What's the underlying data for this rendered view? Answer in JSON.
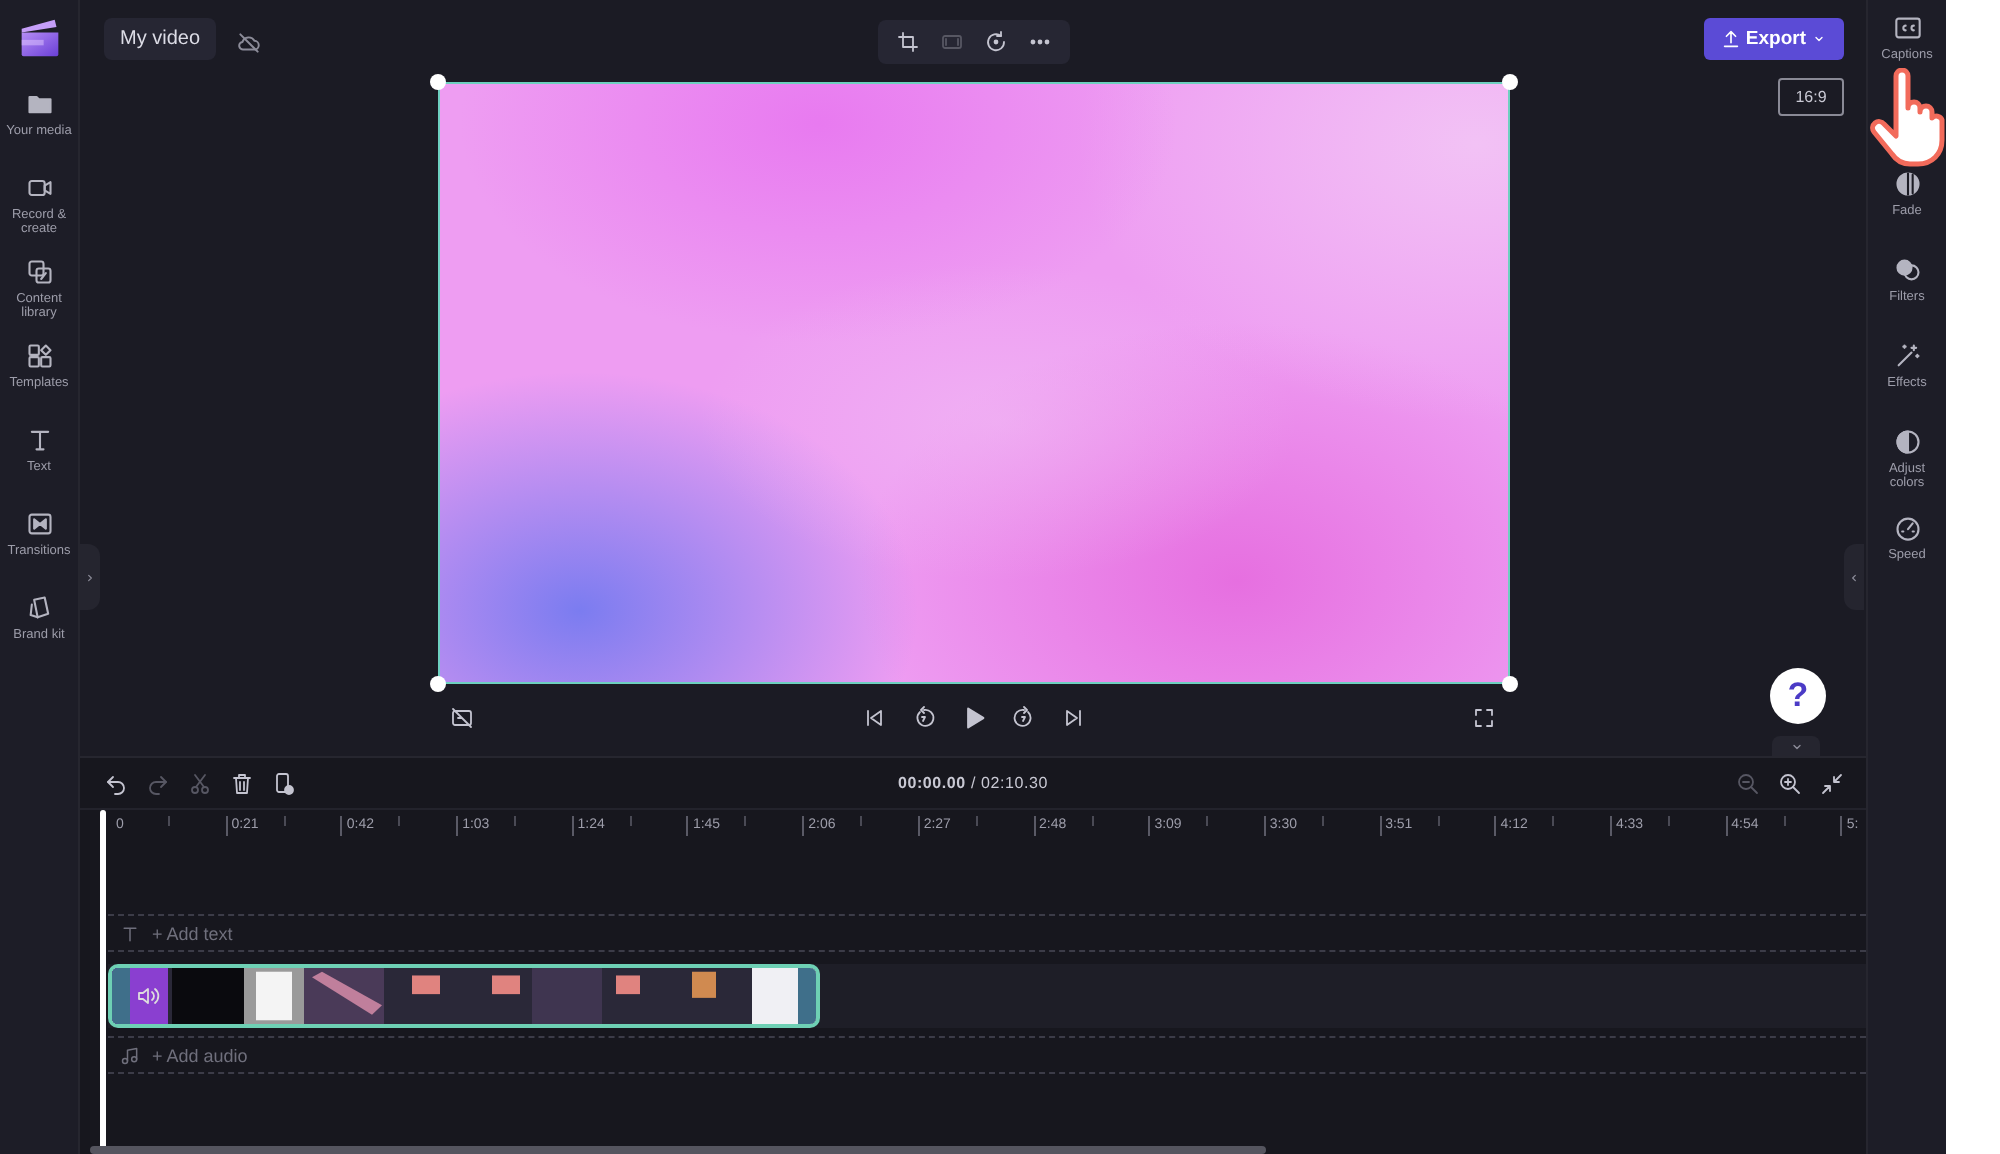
{
  "project_title": "My video",
  "left_nav": [
    {
      "label": "Your media"
    },
    {
      "label": "Record &\ncreate"
    },
    {
      "label": "Content\nlibrary"
    },
    {
      "label": "Templates"
    },
    {
      "label": "Text"
    },
    {
      "label": "Transitions"
    },
    {
      "label": "Brand kit"
    }
  ],
  "preview_tools": [
    {
      "disabled": false
    },
    {
      "disabled": true
    },
    {
      "disabled": false
    },
    {
      "disabled": false
    }
  ],
  "export_button": "Export",
  "aspect_ratio": "16:9",
  "right_nav": [
    {
      "label": "Captions"
    },
    {
      "label": "Fade"
    },
    {
      "label": "Filters"
    },
    {
      "label": "Effects"
    },
    {
      "label": "Adjust\ncolors"
    },
    {
      "label": "Speed"
    }
  ],
  "help_button": "?",
  "timeline_tools": [
    {
      "disabled": false
    },
    {
      "disabled": true
    },
    {
      "disabled": true
    },
    {
      "disabled": false
    },
    {
      "disabled": false
    }
  ],
  "time_display": "**00:00.00** / 02:10.30",
  "zoom_tools": [
    {
      "disabled": true
    },
    {
      "disabled": false
    },
    {
      "disabled": false
    }
  ],
  "ruler_labels": [
    "0",
    "0:21",
    "0:42",
    "1:03",
    "1:24",
    "1:45",
    "2:06",
    "2:27",
    "2:48",
    "3:09",
    "3:30",
    "3:51",
    "4:12",
    "4:33",
    "4:54",
    "5:"
  ],
  "text_track": "+ Add text",
  "audio_track": "+ Add audio"
}
